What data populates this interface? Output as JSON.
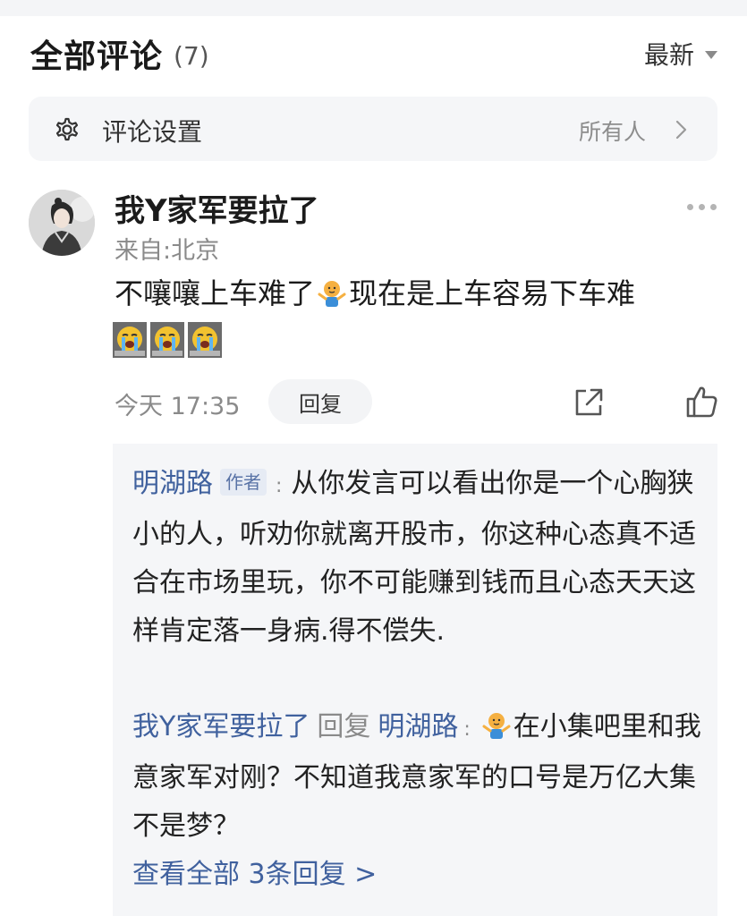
{
  "header": {
    "title": "全部评论",
    "count": "(7)",
    "sort_label": "最新"
  },
  "settings": {
    "label": "评论设置",
    "value": "所有人",
    "gear_icon": "gear-icon",
    "chevron_icon": "chevron-right-icon"
  },
  "comment": {
    "username": "我Y家军要拉了",
    "location": "来自:北京",
    "text_before_emoji": "不嚷嚷上车难了",
    "text_after_emoji": "现在是上车容易下车难",
    "inline_emoji": "shrug-emoji",
    "trailing_emojis": [
      "crying-emoji",
      "crying-emoji",
      "crying-emoji"
    ],
    "time": "今天 17:35",
    "reply_button": "回复",
    "share_icon": "share-icon",
    "like_icon": "thumbs-up-icon"
  },
  "replies": {
    "reply1": {
      "author": "明湖路",
      "author_tag": "作者",
      "separator": ":",
      "text": "从你发言可以看出你是一个心胸狭小的人，听劝你就离开股市，你这种心态真不适合在市场里玩，你不可能赚到钱而且心态天天这样肯定落一身病.得不偿失."
    },
    "reply2": {
      "author": "我Y家军要拉了",
      "reply_word": "回复",
      "target": "明湖路",
      "separator": ":",
      "inline_emoji": "shrug-emoji",
      "text": "在小集吧里和我意家军对刚？不知道我意家军的口号是万亿大集不是梦？"
    },
    "view_all": "查看全部 3条回复 >"
  },
  "colors": {
    "link": "#40619e",
    "muted": "#8a8a8a",
    "panel": "#f5f6f8"
  }
}
